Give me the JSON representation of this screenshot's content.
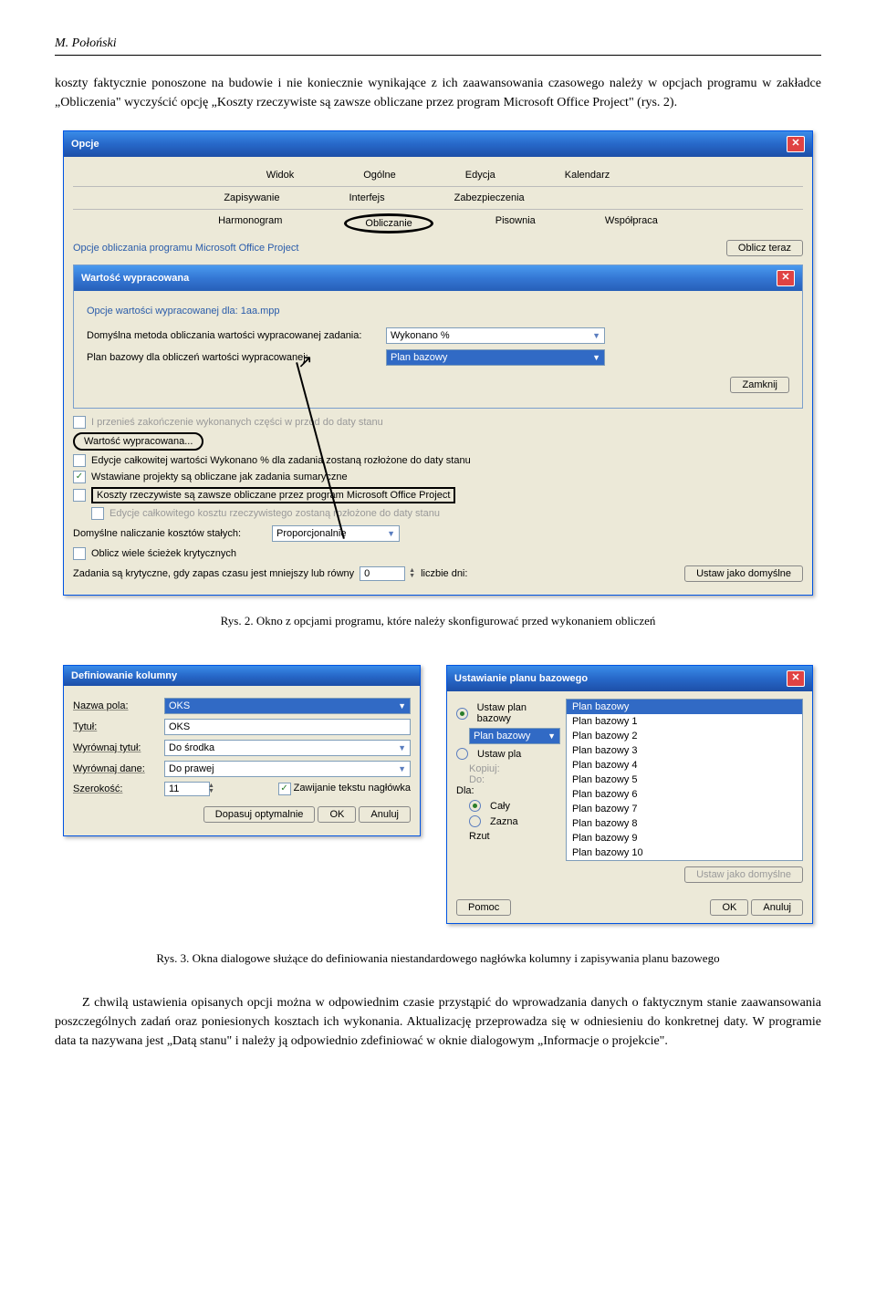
{
  "header": "M. Połoński",
  "para1": "koszty faktycznie ponoszone na budowie i nie koniecznie wynikające z ich zaawansowania czasowego należy w opcjach programu w zakładce „Obliczenia\" wyczyścić opcję „Koszty rzeczywiste są zawsze obliczane przez program Microsoft Office Project\" (rys. 2).",
  "opcje": {
    "title": "Opcje",
    "tabs1": {
      "widok": "Widok",
      "ogolne": "Ogólne",
      "edycja": "Edycja",
      "kalendarz": "Kalendarz"
    },
    "tabs2": {
      "zapisywanie": "Zapisywanie",
      "interfejs": "Interfejs",
      "zabezpieczenia": "Zabezpieczenia"
    },
    "tabs3": {
      "harmonogram": "Harmonogram",
      "obliczanie": "Obliczanie",
      "pisownia": "Pisownia",
      "wspolpraca": "Współpraca"
    },
    "section": "Opcje obliczania programu Microsoft Office Project",
    "btn_oblicz": "Oblicz teraz",
    "inner_title": "Wartość wypracowana",
    "inner_subtitle": "Opcje wartości wypracowanej dla: 1aa.mpp",
    "row1_label": "Domyślna metoda obliczania wartości wypracowanej zadania:",
    "row1_value": "Wykonano %",
    "row2_label": "Plan bazowy dla obliczeń wartości wypracowanej:",
    "row2_value": "Plan bazowy",
    "btn_zamknij": "Zamknij",
    "chk1": "I przenieś zakończenie wykonanych części w przód do daty stanu",
    "btn_wartosc": "Wartość wypracowana...",
    "chk2": "Edycje całkowitej wartości Wykonano % dla zadania zostaną rozłożone do daty stanu",
    "chk3": "Wstawiane projekty są obliczane jak zadania sumaryczne",
    "chk4": "Koszty rzeczywiste są zawsze obliczane przez program Microsoft Office Project",
    "chk5": "Edycje całkowitego kosztu rzeczywistego zostaną rozłożone do daty stanu",
    "row_nalicz_label": "Domyślne naliczanie kosztów stałych:",
    "row_nalicz_value": "Proporcjonalnie",
    "chk6": "Oblicz wiele ścieżek krytycznych",
    "row_kryt_label": "Zadania są krytyczne, gdy zapas czasu jest mniejszy lub równy",
    "row_kryt_value": "0",
    "row_kryt_suffix": "liczbie dni:",
    "btn_domyslne": "Ustaw jako domyślne"
  },
  "caption1": "Rys. 2. Okno z opcjami programu, które należy skonfigurować przed wykonaniem obliczeń",
  "def": {
    "title": "Definiowanie kolumny",
    "nazwa_label": "Nazwa pola:",
    "nazwa_value": "OKS",
    "tytul_label": "Tytuł:",
    "tytul_value": "OKS",
    "wyr_tytul_label": "Wyrównaj tytuł:",
    "wyr_tytul_value": "Do środka",
    "wyr_dane_label": "Wyrównaj dane:",
    "wyr_dane_value": "Do prawej",
    "szer_label": "Szerokość:",
    "szer_value": "11",
    "chk_zawij": "Zawijanie tekstu nagłówka",
    "btn_dopasuj": "Dopasuj optymalnie",
    "btn_ok": "OK",
    "btn_anuluj": "Anuluj"
  },
  "plan": {
    "title": "Ustawianie planu bazowego",
    "r1": "Ustaw plan bazowy",
    "r1_value": "Plan bazowy",
    "r2": "Ustaw pla",
    "kopiuj": "Kopiuj:",
    "do": "Do:",
    "dla": "Dla:",
    "caly": "Cały",
    "zazna": "Zazna",
    "rzut": "Rzut",
    "items": [
      "Plan bazowy",
      "Plan bazowy 1",
      "Plan bazowy 2",
      "Plan bazowy 3",
      "Plan bazowy 4",
      "Plan bazowy 5",
      "Plan bazowy 6",
      "Plan bazowy 7",
      "Plan bazowy 8",
      "Plan bazowy 9",
      "Plan bazowy 10"
    ],
    "btn_dom": "Ustaw jako domyślne",
    "btn_pomoc": "Pomoc",
    "btn_ok": "OK",
    "btn_anuluj": "Anuluj"
  },
  "caption2": "Rys. 3. Okna dialogowe służące do definiowania niestandardowego nagłówka kolumny i zapisywania planu bazowego",
  "para2": "Z chwilą ustawienia opisanych opcji można w odpowiednim czasie przystąpić do wprowadzania danych o faktycznym stanie zaawansowania poszczególnych zadań oraz poniesionych kosztach ich wykonania. Aktualizację przeprowadza się w odniesieniu do konkretnej daty. W programie data ta nazywana jest „Datą stanu\" i należy ją odpowiednio zdefiniować w oknie dialogowym „Informacje o projekcie\"."
}
